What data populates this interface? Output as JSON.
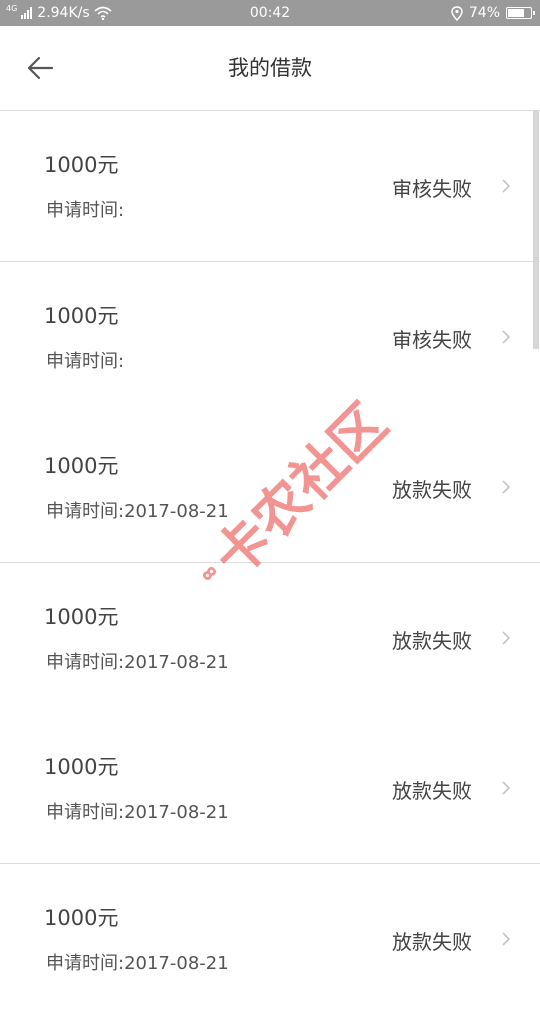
{
  "status_bar": {
    "network": "4G",
    "speed": "2.94K/s",
    "time": "00:42",
    "battery": "74%",
    "battery_level": 0.74
  },
  "header": {
    "title": "我的借款"
  },
  "loans": [
    {
      "amount": "1000元",
      "date_label": "申请时间:",
      "date": "",
      "status": "审核失败"
    },
    {
      "amount": "1000元",
      "date_label": "申请时间:",
      "date": "",
      "status": "审核失败"
    },
    {
      "amount": "1000元",
      "date_label": "申请时间:",
      "date": "2017-08-21",
      "status": "放款失败"
    },
    {
      "amount": "1000元",
      "date_label": "申请时间:",
      "date": "2017-08-21",
      "status": "放款失败"
    },
    {
      "amount": "1000元",
      "date_label": "申请时间:",
      "date": "2017-08-21",
      "status": "放款失败"
    },
    {
      "amount": "1000元",
      "date_label": "申请时间:",
      "date": "2017-08-21",
      "status": "放款失败"
    }
  ],
  "watermark": {
    "text": "卡农社区"
  },
  "colors": {
    "status_bar_bg": "#9a9a9a",
    "divider": "#dcdcdc",
    "watermark": "#f07a78",
    "text": "#444444"
  }
}
